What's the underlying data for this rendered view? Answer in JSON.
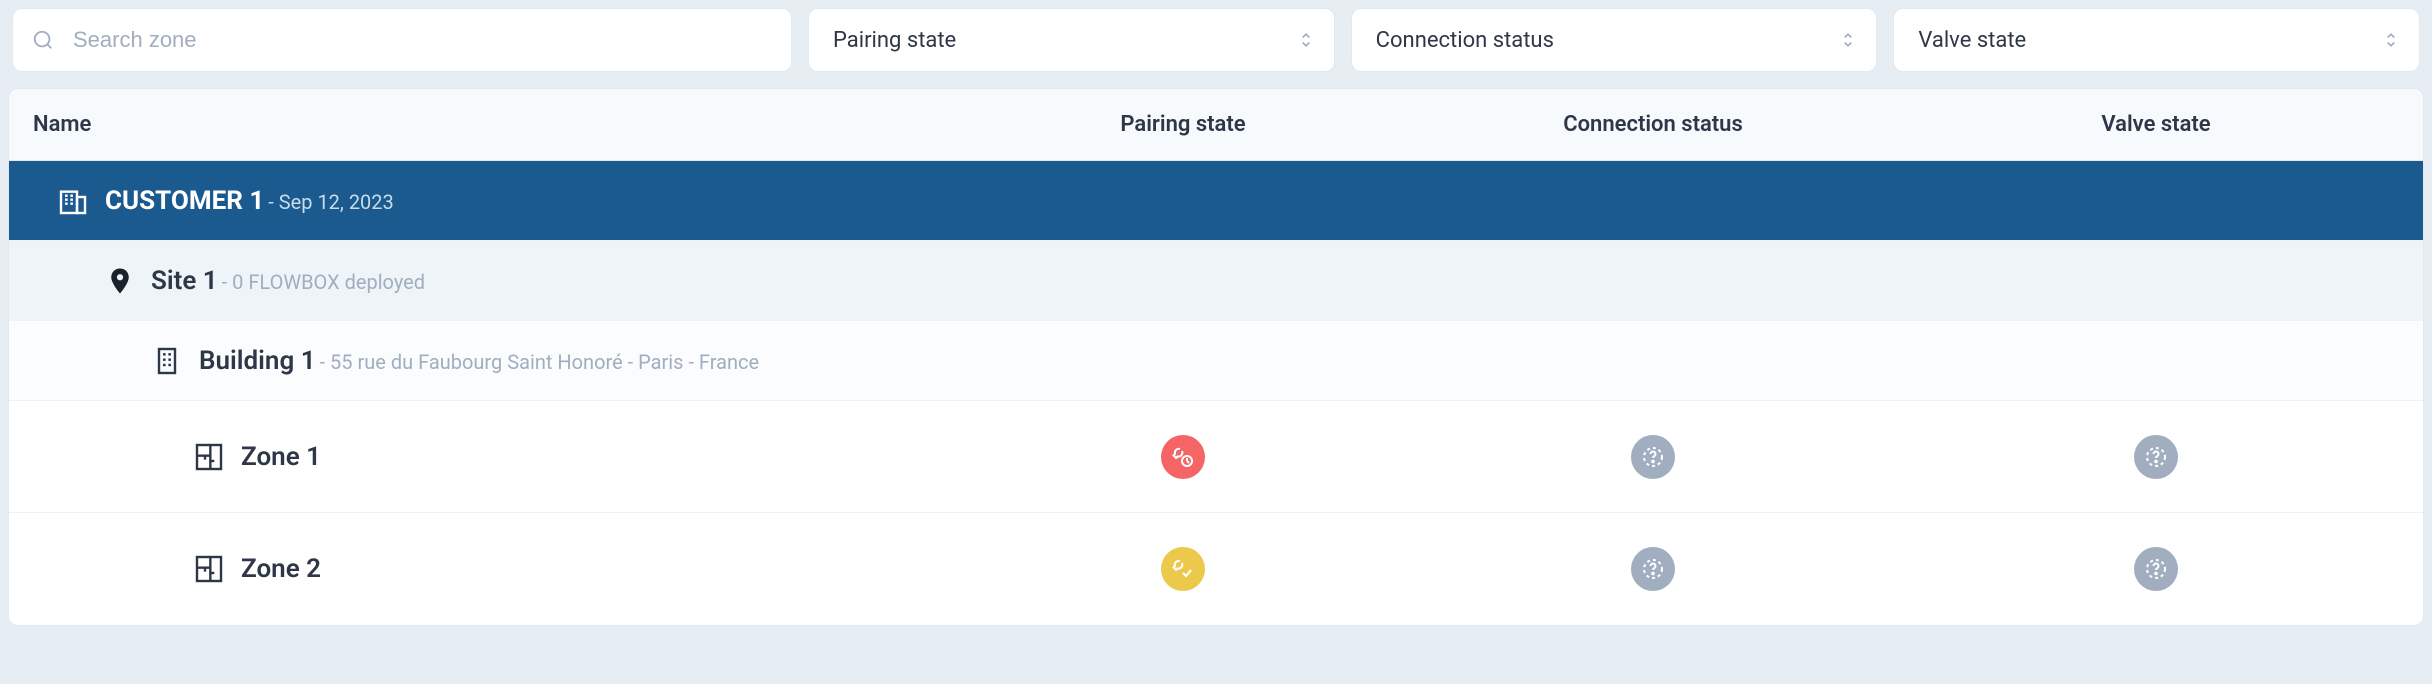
{
  "filters": {
    "search_placeholder": "Search zone",
    "pairing_state_label": "Pairing state",
    "connection_status_label": "Connection status",
    "valve_state_label": "Valve state"
  },
  "table": {
    "headers": {
      "name": "Name",
      "pairing_state": "Pairing state",
      "connection_status": "Connection status",
      "valve_state": "Valve state"
    }
  },
  "customer": {
    "name": "CUSTOMER 1",
    "date_prefix": "- ",
    "date": "Sep 12, 2023"
  },
  "site": {
    "name": "Site 1",
    "meta_prefix": "- ",
    "meta": "0 FLOWBOX deployed"
  },
  "building": {
    "name": "Building 1",
    "meta_prefix": "- ",
    "meta": "55 rue du Faubourg Saint Honoré - Paris - France"
  },
  "zones": [
    {
      "name": "Zone 1",
      "pairing_state": "error",
      "connection_status": "unknown",
      "valve_state": "unknown"
    },
    {
      "name": "Zone 2",
      "pairing_state": "pending",
      "connection_status": "unknown",
      "valve_state": "unknown"
    }
  ],
  "status_colors": {
    "error": "#f56565",
    "pending": "#ecc94b",
    "unknown": "#a0aec0"
  }
}
